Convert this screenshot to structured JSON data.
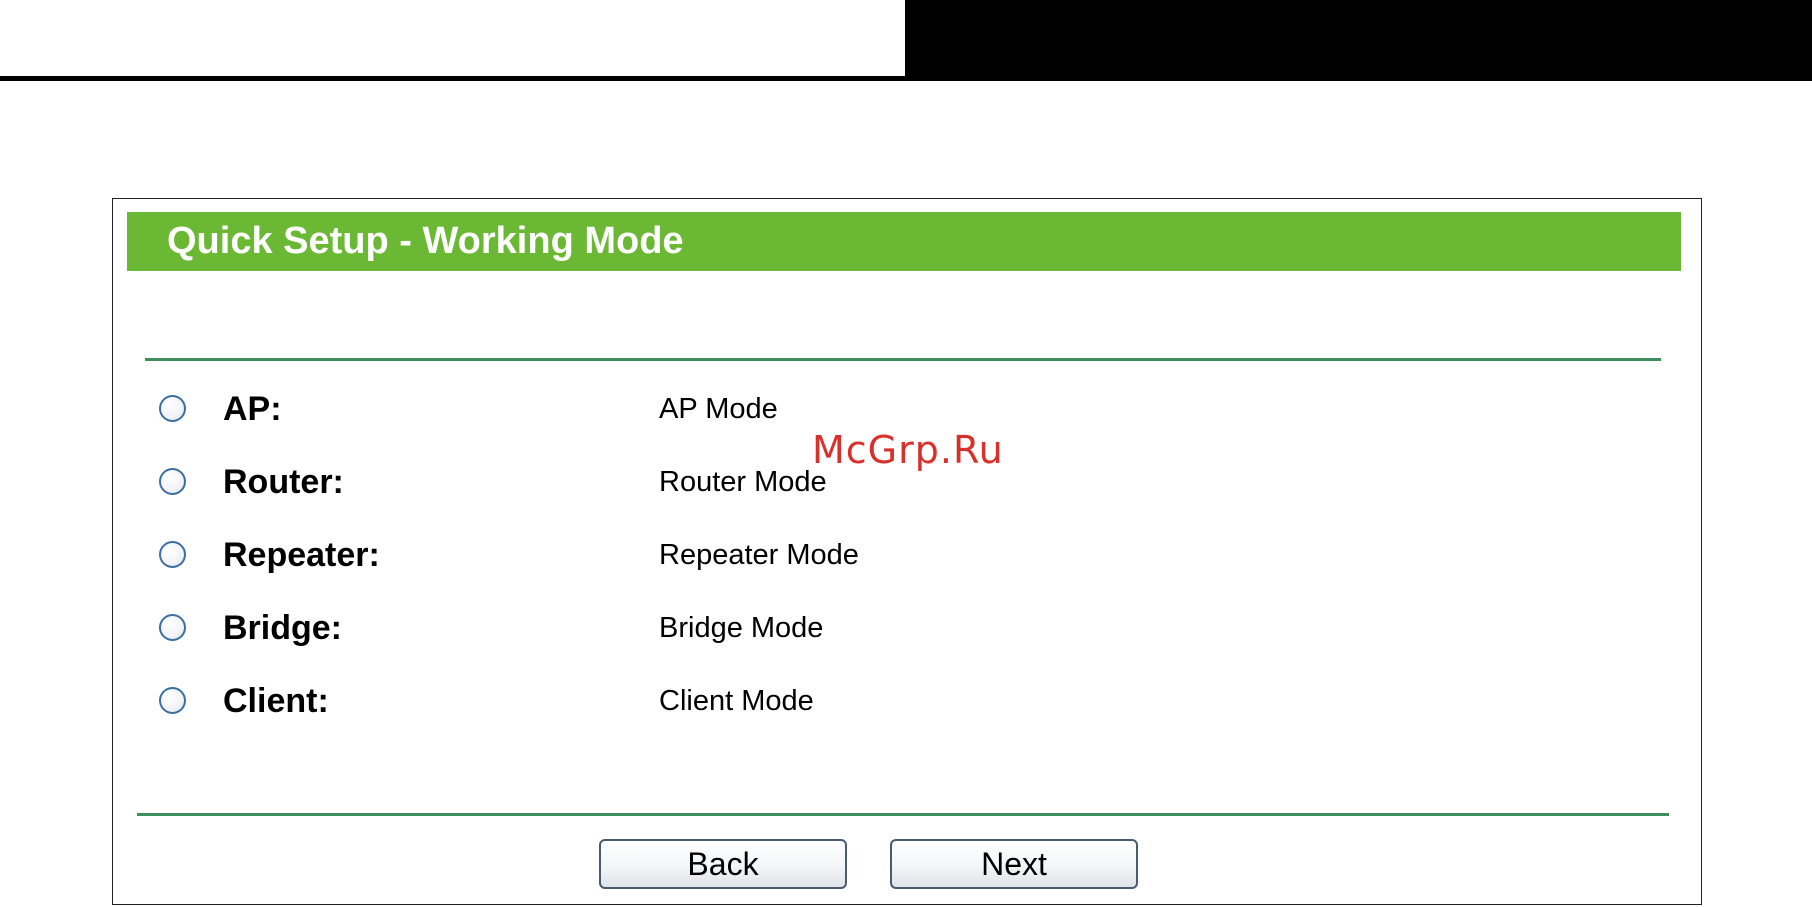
{
  "panel": {
    "title": "Quick Setup - Working Mode"
  },
  "options": [
    {
      "label": "AP:",
      "description": "AP Mode"
    },
    {
      "label": "Router:",
      "description": "Router Mode"
    },
    {
      "label": "Repeater:",
      "description": "Repeater Mode"
    },
    {
      "label": "Bridge:",
      "description": "Bridge Mode"
    },
    {
      "label": "Client:",
      "description": "Client Mode"
    }
  ],
  "buttons": {
    "back": "Back",
    "next": "Next"
  },
  "watermark": "McGrp.Ru",
  "colors": {
    "title_bar": "#6ab833",
    "divider": "#3f8e5d",
    "watermark": "#d9302c"
  }
}
